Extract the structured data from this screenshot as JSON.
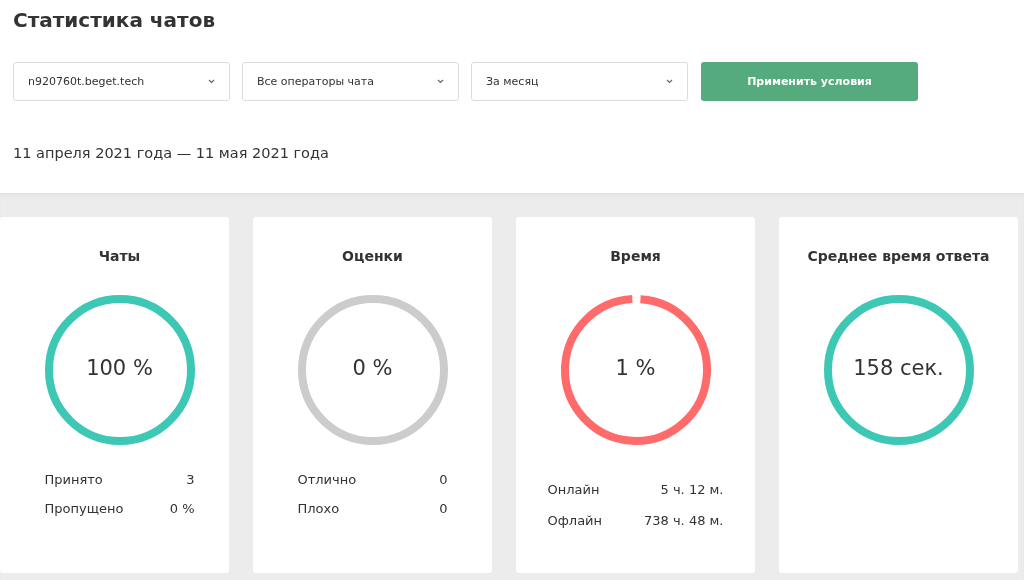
{
  "title": "Статистика чатов",
  "filters": [
    {
      "value": "n920760t.beget.tech"
    },
    {
      "value": "Все операторы чата"
    },
    {
      "value": "За месяц"
    }
  ],
  "apply_button": "Применить условия",
  "period": "11 апреля 2021 года — 11 мая 2021 года",
  "cards": [
    {
      "title": "Чаты",
      "reading": "100 %",
      "color": "#3cc8b4",
      "level": 1,
      "rows": [
        {
          "label": "Принято",
          "value": "3"
        },
        {
          "label": "Пропущено",
          "value": "0 %"
        }
      ]
    },
    {
      "title": "Оценки",
      "reading": "0 %",
      "rows": [
        {
          "label": "Отлично",
          "value": "0"
        },
        {
          "label": "Плохо",
          "value": "0"
        }
      ]
    },
    {
      "title": "Время",
      "reading": "1 %",
      "color": "#ff6b6b",
      "level": 0.98,
      "rows": [
        {
          "label": "Онлайн",
          "value": "5 ч. 12 м."
        },
        {
          "label": "Офлайн",
          "value": "738 ч. 48 м."
        }
      ]
    },
    {
      "title": "Среднее время ответа",
      "reading": "158 сек.",
      "color": "#3cc8b4",
      "level": 1
    }
  ]
}
